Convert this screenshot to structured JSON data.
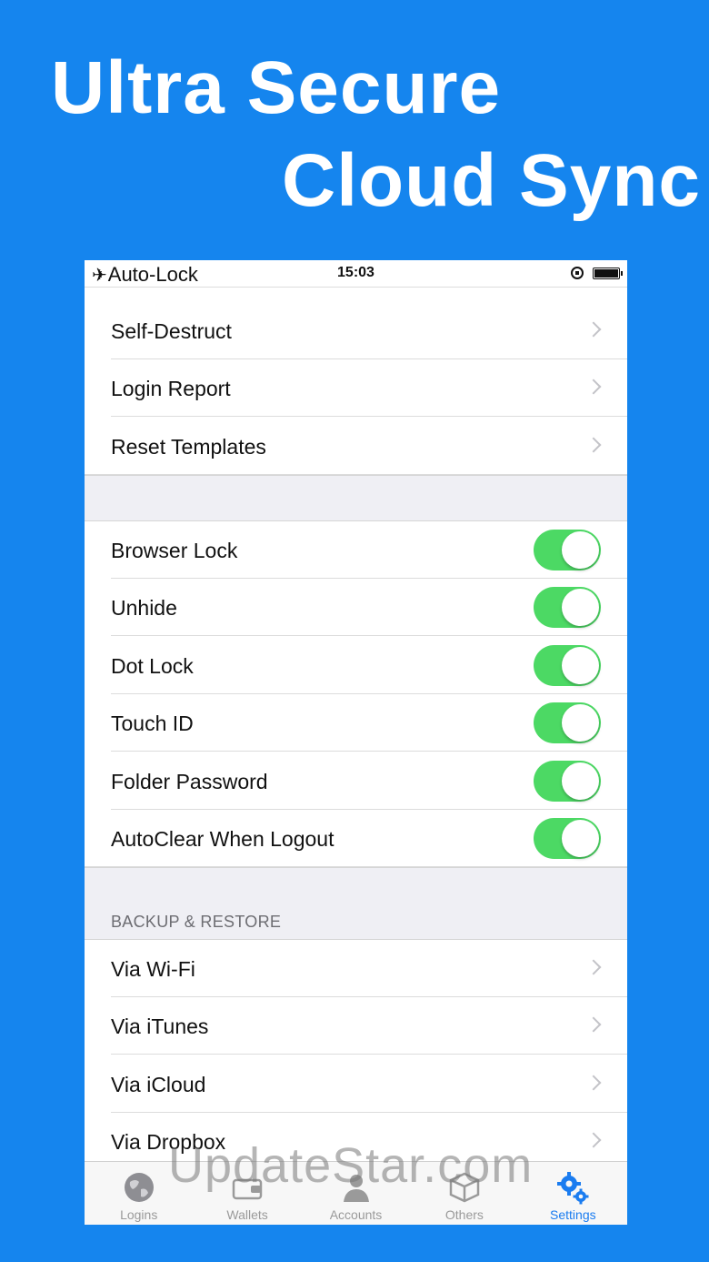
{
  "headline": {
    "line1": "Ultra Secure",
    "line2": "Cloud Sync"
  },
  "status_bar": {
    "left_text": "Auto-Lock",
    "time": "15:03"
  },
  "rows_nav_top": [
    {
      "label": "Self-Destruct"
    },
    {
      "label": "Login Report"
    },
    {
      "label": "Reset Templates"
    }
  ],
  "toggles": [
    {
      "label": "Browser Lock",
      "on": true
    },
    {
      "label": "Unhide",
      "on": true
    },
    {
      "label": "Dot Lock",
      "on": true
    },
    {
      "label": "Touch ID",
      "on": true
    },
    {
      "label": "Folder Password",
      "on": true
    },
    {
      "label": "AutoClear When Logout",
      "on": true
    }
  ],
  "backup_section": {
    "header": "BACKUP & RESTORE",
    "rows": [
      {
        "label": "Via Wi-Fi"
      },
      {
        "label": "Via iTunes"
      },
      {
        "label": "Via iCloud"
      },
      {
        "label": "Via Dropbox"
      }
    ]
  },
  "tab_bar": {
    "tabs": [
      {
        "label": "Logins",
        "icon": "globe-icon",
        "active": false
      },
      {
        "label": "Wallets",
        "icon": "wallet-icon",
        "active": false
      },
      {
        "label": "Accounts",
        "icon": "person-icon",
        "active": false
      },
      {
        "label": "Others",
        "icon": "box-icon",
        "active": false
      },
      {
        "label": "Settings",
        "icon": "gears-icon",
        "active": true
      }
    ]
  },
  "watermark": "UpdateStar.com",
  "colors": {
    "background": "#1585ee",
    "toggle_on": "#4cd964",
    "active_tab": "#1a7cf0",
    "inactive_tab": "#9a9a9a"
  }
}
